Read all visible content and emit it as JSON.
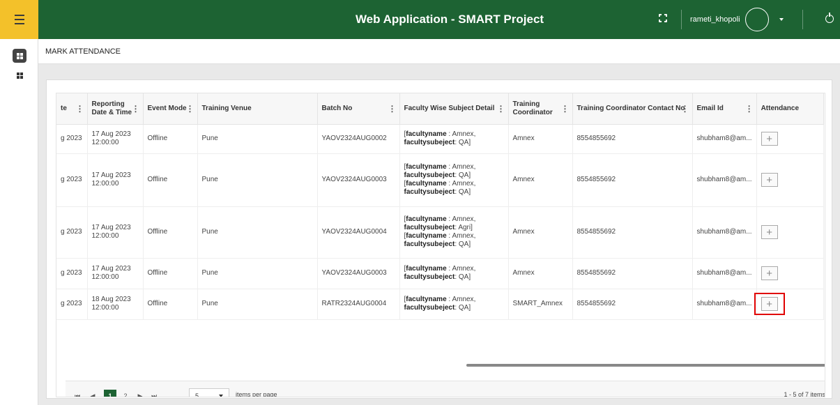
{
  "header": {
    "title": "Web Application - SMART Project",
    "username": "rameti_khopoli"
  },
  "page": {
    "title": "MARK ATTENDANCE"
  },
  "table": {
    "columns": [
      "te",
      "Reporting Date & Time",
      "Event Mode",
      "Training Venue",
      "Batch No",
      "Faculty Wise Subject Detail",
      "Training Coordinator",
      "Training Coordinator Contact No",
      "Email Id",
      "Attendance"
    ],
    "rows": [
      {
        "date": "g 2023",
        "reporting": "17 Aug 2023 12:00:00",
        "mode": "Offline",
        "venue": "Pune",
        "batch": "YAOV2324AUG0002",
        "faculty": [
          {
            "name": "Amnex",
            "subject": "QA"
          }
        ],
        "coordinator": "Amnex",
        "contact": "8554855692",
        "email": "shubham8@am..."
      },
      {
        "date": "g 2023",
        "reporting": "17 Aug 2023 12:00:00",
        "mode": "Offline",
        "venue": "Pune",
        "batch": "YAOV2324AUG0003",
        "faculty": [
          {
            "name": "Amnex",
            "subject": "QA"
          },
          {
            "name": "Amnex",
            "subject": "QA"
          }
        ],
        "coordinator": "Amnex",
        "contact": "8554855692",
        "email": "shubham8@am..."
      },
      {
        "date": "g 2023",
        "reporting": "17 Aug 2023 12:00:00",
        "mode": "Offline",
        "venue": "Pune",
        "batch": "YAOV2324AUG0004",
        "faculty": [
          {
            "name": "Amnex",
            "subject": "Agri"
          },
          {
            "name": "Amnex",
            "subject": "QA"
          }
        ],
        "coordinator": "Amnex",
        "contact": "8554855692",
        "email": "shubham8@am..."
      },
      {
        "date": "g 2023",
        "reporting": "17 Aug 2023 12:00:00",
        "mode": "Offline",
        "venue": "Pune",
        "batch": "YAOV2324AUG0003",
        "faculty": [
          {
            "name": "Amnex",
            "subject": "QA"
          }
        ],
        "coordinator": "Amnex",
        "contact": "8554855692",
        "email": "shubham8@am..."
      },
      {
        "date": "g 2023",
        "reporting": "18 Aug 2023 12:00:00",
        "mode": "Offline",
        "venue": "Pune",
        "batch": "RATR2324AUG0004",
        "faculty": [
          {
            "name": "Amnex",
            "subject": "QA"
          }
        ],
        "coordinator": "SMART_Amnex",
        "contact": "8554855692",
        "email": "shubham8@am...",
        "highlighted": true
      }
    ],
    "faculty_name_key": "facultyname",
    "faculty_subject_key": "facultysubeject",
    "attendance_button": "+"
  },
  "pager": {
    "pages": [
      "1",
      "2"
    ],
    "active_page": "1",
    "page_size": "5",
    "items_per_page_label": "items per page",
    "info": "1 - 5 of 7 items",
    "first_icon": "first-page-icon",
    "prev_icon": "prev-page-icon",
    "next_icon": "next-page-icon",
    "last_icon": "last-page-icon"
  },
  "colors": {
    "brand_green": "#1d6333",
    "menu_yellow": "#f3c12a",
    "highlight_red": "#e00000"
  }
}
